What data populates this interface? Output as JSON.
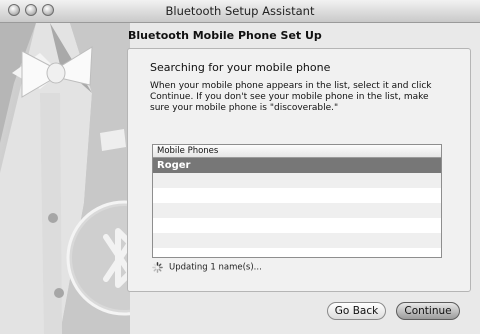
{
  "window": {
    "title": "Bluetooth Setup Assistant"
  },
  "page": {
    "heading": "Bluetooth Mobile Phone Set Up",
    "subheading": "Searching for your mobile phone",
    "instructions": "When your mobile phone appears in the list, select it and click Continue. If you don't see your mobile phone in the list, make sure your mobile phone is \"discoverable.\""
  },
  "list": {
    "header": "Mobile Phones",
    "selected_index": 0,
    "items": [
      "Roger",
      "",
      "",
      "",
      "",
      "",
      ""
    ]
  },
  "status": {
    "text": "Updating 1 name(s)..."
  },
  "buttons": {
    "back_label": "Go Back",
    "continue_label": "Continue"
  }
}
